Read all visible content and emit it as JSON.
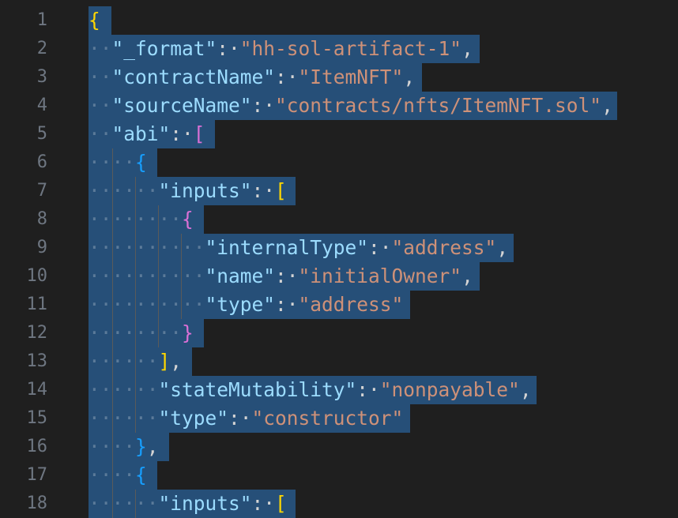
{
  "editor": {
    "line_numbers": [
      "1",
      "2",
      "3",
      "4",
      "5",
      "6",
      "7",
      "8",
      "9",
      "10",
      "11",
      "12",
      "13",
      "14",
      "15",
      "16",
      "17",
      "18"
    ],
    "colors": {
      "background": "#1f1f1f",
      "selection": "#264f78",
      "key": "#9cdcfe",
      "string": "#ce9178",
      "bracket_level1": "#ffd700",
      "bracket_level2": "#da70d6",
      "bracket_level3": "#179fff"
    },
    "lines": [
      [
        {
          "t": "b1",
          "v": "{"
        }
      ],
      [
        {
          "t": "ws",
          "v": "··"
        },
        {
          "t": "key",
          "v": "\"_format\""
        },
        {
          "t": "punc",
          "v": ":·"
        },
        {
          "t": "str",
          "v": "\"hh-sol-artifact-1\""
        },
        {
          "t": "punc",
          "v": ","
        }
      ],
      [
        {
          "t": "ws",
          "v": "··"
        },
        {
          "t": "key",
          "v": "\"contractName\""
        },
        {
          "t": "punc",
          "v": ":·"
        },
        {
          "t": "str",
          "v": "\"ItemNFT\""
        },
        {
          "t": "punc",
          "v": ","
        }
      ],
      [
        {
          "t": "ws",
          "v": "··"
        },
        {
          "t": "key",
          "v": "\"sourceName\""
        },
        {
          "t": "punc",
          "v": ":·"
        },
        {
          "t": "str",
          "v": "\"contracts/nfts/ItemNFT.sol\""
        },
        {
          "t": "punc",
          "v": ","
        }
      ],
      [
        {
          "t": "ws",
          "v": "··"
        },
        {
          "t": "key",
          "v": "\"abi\""
        },
        {
          "t": "punc",
          "v": ":·"
        },
        {
          "t": "b2",
          "v": "["
        }
      ],
      [
        {
          "t": "ws",
          "v": "····"
        },
        {
          "t": "b3",
          "v": "{"
        }
      ],
      [
        {
          "t": "ws",
          "v": "······"
        },
        {
          "t": "key",
          "v": "\"inputs\""
        },
        {
          "t": "punc",
          "v": ":·"
        },
        {
          "t": "b1",
          "v": "["
        }
      ],
      [
        {
          "t": "ws",
          "v": "········"
        },
        {
          "t": "b2",
          "v": "{"
        }
      ],
      [
        {
          "t": "ws",
          "v": "··········"
        },
        {
          "t": "key",
          "v": "\"internalType\""
        },
        {
          "t": "punc",
          "v": ":·"
        },
        {
          "t": "str",
          "v": "\"address\""
        },
        {
          "t": "punc",
          "v": ","
        }
      ],
      [
        {
          "t": "ws",
          "v": "··········"
        },
        {
          "t": "key",
          "v": "\"name\""
        },
        {
          "t": "punc",
          "v": ":·"
        },
        {
          "t": "str",
          "v": "\"initialOwner\""
        },
        {
          "t": "punc",
          "v": ","
        }
      ],
      [
        {
          "t": "ws",
          "v": "··········"
        },
        {
          "t": "key",
          "v": "\"type\""
        },
        {
          "t": "punc",
          "v": ":·"
        },
        {
          "t": "str",
          "v": "\"address\""
        }
      ],
      [
        {
          "t": "ws",
          "v": "········"
        },
        {
          "t": "b2",
          "v": "}"
        }
      ],
      [
        {
          "t": "ws",
          "v": "······"
        },
        {
          "t": "b1",
          "v": "]"
        },
        {
          "t": "punc",
          "v": ","
        }
      ],
      [
        {
          "t": "ws",
          "v": "······"
        },
        {
          "t": "key",
          "v": "\"stateMutability\""
        },
        {
          "t": "punc",
          "v": ":·"
        },
        {
          "t": "str",
          "v": "\"nonpayable\""
        },
        {
          "t": "punc",
          "v": ","
        }
      ],
      [
        {
          "t": "ws",
          "v": "······"
        },
        {
          "t": "key",
          "v": "\"type\""
        },
        {
          "t": "punc",
          "v": ":·"
        },
        {
          "t": "str",
          "v": "\"constructor\""
        }
      ],
      [
        {
          "t": "ws",
          "v": "····"
        },
        {
          "t": "b3",
          "v": "}"
        },
        {
          "t": "punc",
          "v": ","
        }
      ],
      [
        {
          "t": "ws",
          "v": "····"
        },
        {
          "t": "b3",
          "v": "{"
        }
      ],
      [
        {
          "t": "ws",
          "v": "······"
        },
        {
          "t": "key",
          "v": "\"inputs\""
        },
        {
          "t": "punc",
          "v": ":·"
        },
        {
          "t": "b1",
          "v": "["
        }
      ]
    ]
  }
}
